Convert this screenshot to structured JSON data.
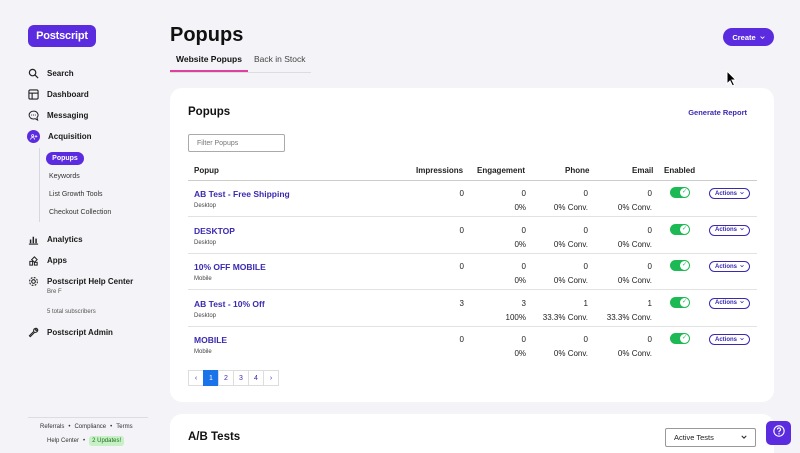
{
  "brand": {
    "logo_text": "Postscript",
    "accent": "#5b2be0"
  },
  "sidebar": {
    "items": [
      {
        "label": "Search",
        "icon": "search-icon"
      },
      {
        "label": "Dashboard",
        "icon": "dashboard-icon"
      },
      {
        "label": "Messaging",
        "icon": "message-icon"
      },
      {
        "label": "Acquisition",
        "icon": "acquisition-icon"
      },
      {
        "label": "Analytics",
        "icon": "analytics-icon"
      },
      {
        "label": "Apps",
        "icon": "apps-icon"
      },
      {
        "label": "Postscript Help Center",
        "icon": "gear-icon"
      },
      {
        "label": "Postscript Admin",
        "icon": "wrench-icon"
      }
    ],
    "acquisition_sub": [
      "Popups",
      "Keywords",
      "List Growth Tools",
      "Checkout Collection"
    ],
    "user_name": "Bre F",
    "subscribers": "5 total subscribers",
    "footer": {
      "referrals": "Referrals",
      "compliance": "Compliance",
      "terms": "Terms",
      "help_center": "Help Center",
      "updates": "2 Updates!",
      "sep": "•"
    }
  },
  "header": {
    "title": "Popups",
    "tabs": [
      "Website Popups",
      "Back in Stock"
    ],
    "create_label": "Create"
  },
  "popups_card": {
    "title": "Popups",
    "generate_report": "Generate Report",
    "filter_placeholder": "Filter Popups",
    "columns": [
      "Popup",
      "Impressions",
      "Engagement",
      "Phone",
      "Email",
      "Enabled"
    ],
    "actions_label": "Actions",
    "rows": [
      {
        "name": "AB Test - Free Shipping",
        "device": "Desktop",
        "impressions": "0",
        "engagement": "0",
        "engagement_pct": "0%",
        "phone": "0",
        "phone_conv": "0% Conv.",
        "email": "0",
        "email_conv": "0% Conv.",
        "enabled": true
      },
      {
        "name": "DESKTOP",
        "device": "Desktop",
        "impressions": "0",
        "engagement": "0",
        "engagement_pct": "0%",
        "phone": "0",
        "phone_conv": "0% Conv.",
        "email": "0",
        "email_conv": "0% Conv.",
        "enabled": true
      },
      {
        "name": "10% OFF MOBILE",
        "device": "Mobile",
        "impressions": "0",
        "engagement": "0",
        "engagement_pct": "0%",
        "phone": "0",
        "phone_conv": "0% Conv.",
        "email": "0",
        "email_conv": "0% Conv.",
        "enabled": true
      },
      {
        "name": "AB Test - 10% Off",
        "device": "Desktop",
        "impressions": "3",
        "engagement": "3",
        "engagement_pct": "100%",
        "phone": "1",
        "phone_conv": "33.3% Conv.",
        "email": "1",
        "email_conv": "33.3% Conv.",
        "enabled": true
      },
      {
        "name": "MOBILE",
        "device": "Mobile",
        "impressions": "0",
        "engagement": "0",
        "engagement_pct": "0%",
        "phone": "0",
        "phone_conv": "0% Conv.",
        "email": "0",
        "email_conv": "0% Conv.",
        "enabled": true
      }
    ],
    "pagination": {
      "prev": "‹",
      "pages": [
        "1",
        "2",
        "3",
        "4"
      ],
      "next": "›",
      "current": "1"
    }
  },
  "ab_card": {
    "title": "A/B Tests",
    "select_value": "Active Tests"
  }
}
